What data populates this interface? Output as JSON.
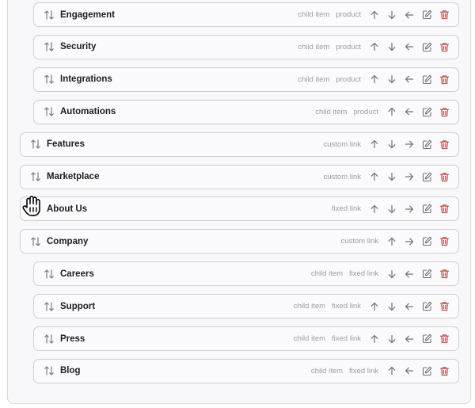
{
  "menu": {
    "items": [
      {
        "label": "Engagement",
        "level": "child",
        "tags": [
          "child item",
          "product"
        ],
        "actions": [
          "up",
          "down",
          "left",
          "edit",
          "delete"
        ]
      },
      {
        "label": "Security",
        "level": "child",
        "tags": [
          "child item",
          "product"
        ],
        "actions": [
          "up",
          "down",
          "left",
          "edit",
          "delete"
        ]
      },
      {
        "label": "Integrations",
        "level": "child",
        "tags": [
          "child item",
          "product"
        ],
        "actions": [
          "up",
          "down",
          "left",
          "edit",
          "delete"
        ]
      },
      {
        "label": "Automations",
        "level": "child",
        "tags": [
          "child item",
          "product"
        ],
        "actions": [
          "up",
          "left",
          "edit",
          "delete"
        ]
      },
      {
        "label": "Features",
        "level": "top",
        "tags": [
          "custom link"
        ],
        "actions": [
          "up",
          "down",
          "right",
          "edit",
          "delete"
        ]
      },
      {
        "label": "Marketplace",
        "level": "top",
        "tags": [
          "custom link"
        ],
        "actions": [
          "up",
          "down",
          "right",
          "edit",
          "delete"
        ]
      },
      {
        "label": "About Us",
        "level": "top",
        "tags": [
          "fixed link"
        ],
        "actions": [
          "up",
          "down",
          "right",
          "edit",
          "delete"
        ]
      },
      {
        "label": "Company",
        "level": "top",
        "tags": [
          "custom link"
        ],
        "actions": [
          "up",
          "right",
          "edit",
          "delete"
        ]
      },
      {
        "label": "Careers",
        "level": "child",
        "tags": [
          "child item",
          "fixed link"
        ],
        "actions": [
          "down",
          "left",
          "edit",
          "delete"
        ]
      },
      {
        "label": "Support",
        "level": "child",
        "tags": [
          "child item",
          "fixed link"
        ],
        "actions": [
          "up",
          "down",
          "left",
          "edit",
          "delete"
        ]
      },
      {
        "label": "Press",
        "level": "child",
        "tags": [
          "child item",
          "fixed link"
        ],
        "actions": [
          "up",
          "down",
          "left",
          "edit",
          "delete"
        ]
      },
      {
        "label": "Blog",
        "level": "child",
        "tags": [
          "child item",
          "fixed link"
        ],
        "actions": [
          "up",
          "left",
          "edit",
          "delete"
        ]
      }
    ]
  },
  "icons": {
    "drag": "drag-sort-icon",
    "up": "arrow-up-icon",
    "down": "arrow-down-icon",
    "left": "arrow-left-icon",
    "right": "arrow-right-icon",
    "edit": "edit-icon",
    "delete": "trash-icon",
    "cursor": "grab-hand-cursor-icon"
  },
  "colors": {
    "delete": "#c44a45",
    "icon": "#6f6f78",
    "tag": "#9a9aa3",
    "border": "#cfcfd5"
  }
}
